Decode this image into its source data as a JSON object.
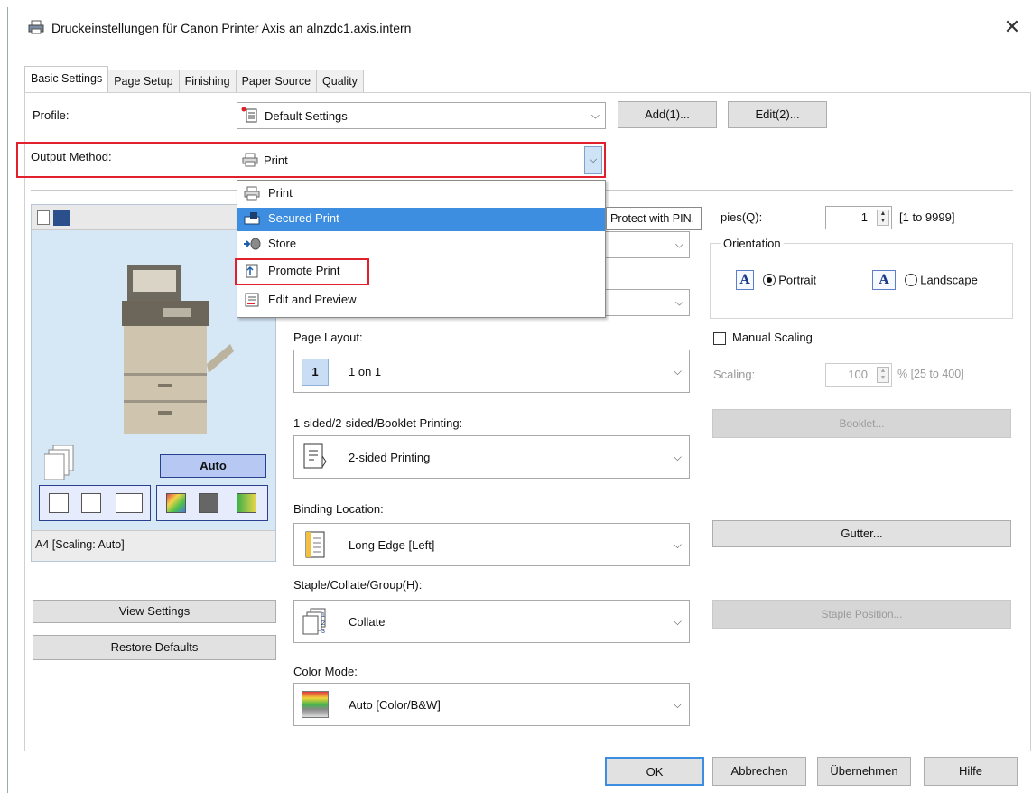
{
  "window": {
    "title": "Druckeinstellungen für Canon Printer Axis an alnzdc1.axis.intern",
    "close": "✕"
  },
  "tabs": [
    "Basic Settings",
    "Page Setup",
    "Finishing",
    "Paper Source",
    "Quality"
  ],
  "profile": {
    "label": "Profile:",
    "value": "Default Settings",
    "add": "Add(1)...",
    "edit": "Edit(2)..."
  },
  "output": {
    "label": "Output Method:",
    "value": "Print"
  },
  "dropdown": {
    "items": [
      "Print",
      "Secured Print",
      "Store",
      "Promote Print",
      "Edit and Preview"
    ],
    "selected_index": 1
  },
  "tooltip": "Protect with PIN.",
  "copies": {
    "label": "pies(Q):",
    "value": "1",
    "range": "[1 to 9999]"
  },
  "orientation": {
    "label": "Orientation",
    "portrait": "Portrait",
    "landscape": "Landscape",
    "portrait_icon": "A",
    "landscape_icon": "A"
  },
  "manual_scaling": {
    "label": "Manual Scaling",
    "checked": false
  },
  "scaling": {
    "label": "Scaling:",
    "value": "100",
    "range": "% [25 to 400]"
  },
  "booklet_btn": "Booklet...",
  "gutter_btn": "Gutter...",
  "staple_btn": "Staple Position...",
  "page_layout": {
    "label": "Page Layout:",
    "value": "1 on 1",
    "icon_text": "1"
  },
  "sided": {
    "label": "1-sided/2-sided/Booklet Printing:",
    "value": "2-sided Printing"
  },
  "binding": {
    "label": "Binding Location:",
    "value": "Long Edge [Left]"
  },
  "staple": {
    "label": "Staple/Collate/Group(H):",
    "value": "Collate"
  },
  "color_mode": {
    "label": "Color Mode:",
    "value": "Auto [Color/B&W]"
  },
  "preview": {
    "auto_btn": "Auto",
    "caption": "A4 [Scaling: Auto]"
  },
  "view_settings": "View Settings",
  "restore_defaults": "Restore Defaults",
  "footer": {
    "ok": "OK",
    "cancel": "Abbrechen",
    "apply": "Übernehmen",
    "help": "Hilfe"
  },
  "colors": {
    "highlight": "#3d8ee0",
    "red_outline": "#e0202a",
    "preview_bg": "#d6e7f6"
  }
}
